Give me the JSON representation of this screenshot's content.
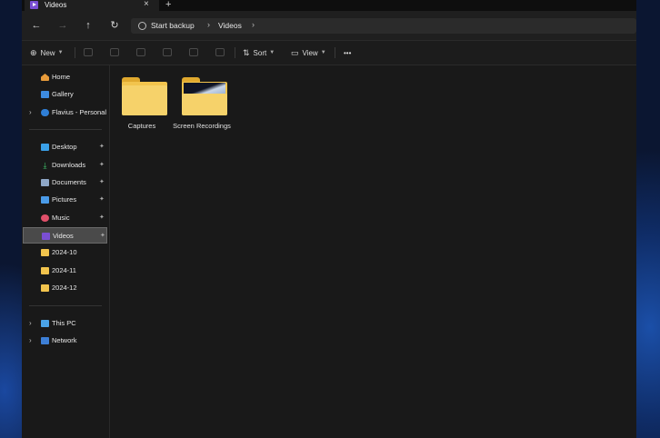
{
  "tab": {
    "title": "Videos",
    "close": "×",
    "new_tab": "+"
  },
  "nav": {
    "back": "←",
    "forward": "→",
    "up": "↑",
    "refresh": "↻"
  },
  "address": {
    "crumbs": [
      "Start backup",
      "Videos"
    ],
    "sep": "›"
  },
  "commands": {
    "new_label": "New",
    "sort_label": "Sort",
    "view_label": "View",
    "more": "•••"
  },
  "sidebar": {
    "quick": [
      {
        "label": "Home",
        "icon": "home-icon"
      },
      {
        "label": "Gallery",
        "icon": "gallery-icon"
      },
      {
        "label": "Flavius - Personal",
        "icon": "onedrive-cloud-icon"
      }
    ],
    "pinned": [
      {
        "label": "Desktop",
        "icon": "desktop-icon"
      },
      {
        "label": "Downloads",
        "icon": "download-icon"
      },
      {
        "label": "Documents",
        "icon": "documents-icon"
      },
      {
        "label": "Pictures",
        "icon": "pictures-icon"
      },
      {
        "label": "Music",
        "icon": "music-icon"
      },
      {
        "label": "Videos",
        "icon": "videos-icon"
      },
      {
        "label": "2024-10",
        "icon": "folder-icon"
      },
      {
        "label": "2024-11",
        "icon": "folder-icon"
      },
      {
        "label": "2024-12",
        "icon": "folder-icon"
      }
    ],
    "devices": [
      {
        "label": "This PC",
        "icon": "pc-icon"
      },
      {
        "label": "Network",
        "icon": "network-icon"
      }
    ],
    "selected": "Videos"
  },
  "content": {
    "items": [
      {
        "label": "Captures",
        "type": "folder"
      },
      {
        "label": "Screen Recordings",
        "type": "folder-with-preview"
      }
    ]
  },
  "colors": {
    "window_bg": "#191919",
    "folder_yellow": "#f2c44d",
    "accent_videos": "#7a4fd3",
    "desktop_blue": "#1b4fa8"
  }
}
